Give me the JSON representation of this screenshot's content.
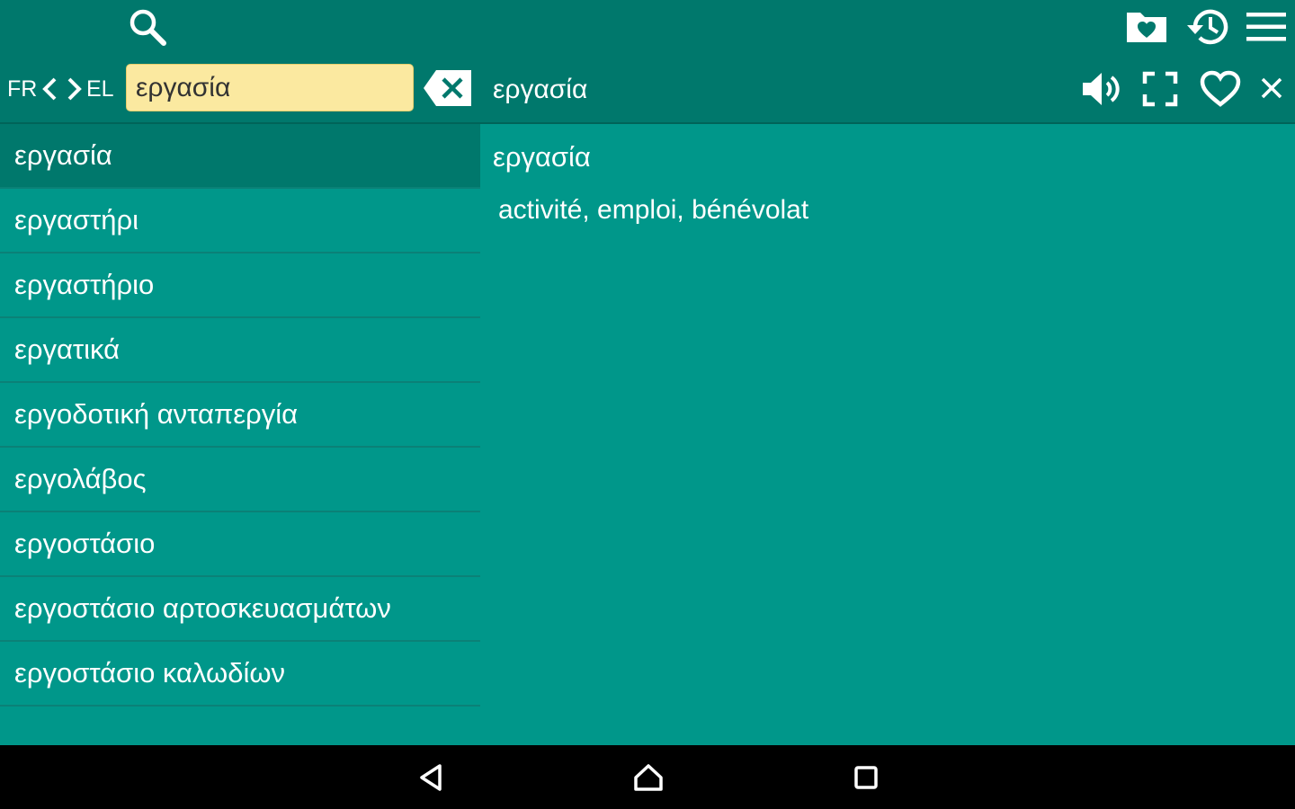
{
  "toolbar": {
    "icons": [
      "search-icon",
      "favorites-folder-icon",
      "history-icon",
      "menu-icon"
    ]
  },
  "language": {
    "source": "FR",
    "target": "EL"
  },
  "search": {
    "value": "εργασία"
  },
  "detail": {
    "header_word": "εργασία",
    "word": "εργασία",
    "translation": "activité, emploi, bénévolat",
    "icons": [
      "speaker-icon",
      "fullscreen-icon",
      "heart-icon",
      "close-icon"
    ]
  },
  "word_list": [
    "εργασία",
    "εργαστήρι",
    "εργαστήριο",
    "εργατικά",
    "εργοδοτική ανταπεργία",
    "εργολάβος",
    "εργοστάσιο",
    "εργοστάσιο αρτοσκευασμάτων",
    "εργοστάσιο καλωδίων"
  ],
  "selected_index": 0,
  "navigation": {
    "icons": [
      "back-icon",
      "home-icon",
      "recents-icon"
    ]
  },
  "colors": {
    "accent": "#00978a",
    "toolbar": "#00786c",
    "search_field": "#fbe9a0",
    "navbar": "#000000"
  }
}
